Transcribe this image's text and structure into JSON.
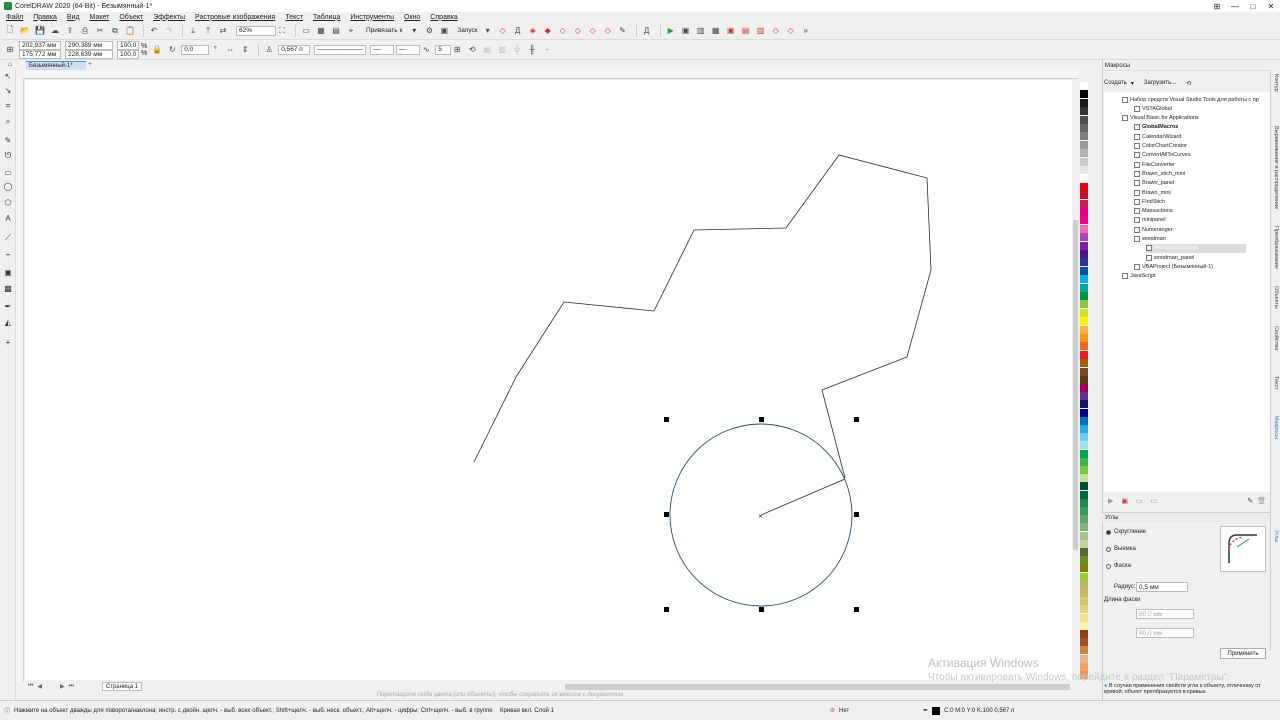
{
  "window": {
    "title": "CorelDRAW 2020 (64-Bit) - Безымянный-1*"
  },
  "menu": [
    "Файл",
    "Правка",
    "Вид",
    "Макет",
    "Объект",
    "Эффекты",
    "Растровые изображения",
    "Текст",
    "Таблица",
    "Инструменты",
    "Окно",
    "Справка"
  ],
  "toolbar1": {
    "zoom": "62%",
    "snap_label": "Привязать к",
    "launch_label": "Запуск"
  },
  "toolbar2": {
    "x": "202,937 мм",
    "y": "175,772 мм",
    "w": "290,389 мм",
    "h": "228,639 мм",
    "scale_w": "100,0",
    "scale_h": "100,0",
    "percent": "%",
    "angle": "0,0",
    "outline_width": "0,567 п",
    "curve_nodes": "5"
  },
  "document": {
    "tab": "Безымянный-1*",
    "page_tab": "Страница 1"
  },
  "canvas_hint": "Перетащите сюда цвета (или объекты), чтобы сохранить их вместе с документом",
  "status": {
    "message": "Нажмите на объект дважды для поворота/наклона; инстр. с двойн. щелч. - выб. всех объект.; Shift+щелч. - выб. неск. объект.; Alt+щелч. - цифры; Ctrl+щелч. - выб. в группе",
    "layer": "Кривая вкл. Слой 1",
    "fill": "Нет",
    "outline": "C:0 M:0 Y:0 K:100  0,567 п"
  },
  "macros": {
    "panel_title": "Макросы",
    "create": "Создать",
    "load": "Загрузить...",
    "tree": [
      {
        "label": "Набор средств Visual Studio Tools для работы с пр",
        "level": 0
      },
      {
        "label": "VSTAGlobal",
        "level": 1
      },
      {
        "label": "Visual Basic for Applications",
        "level": 0
      },
      {
        "label": "GlobalMacros",
        "level": 1,
        "bold": true
      },
      {
        "label": "CalendarWizard",
        "level": 1
      },
      {
        "label": "ColorChartCreator",
        "level": 1
      },
      {
        "label": "ConvertAllToCurves",
        "level": 1
      },
      {
        "label": "FileConverter",
        "level": 1
      },
      {
        "label": "Brawo_stich_mini",
        "level": 1
      },
      {
        "label": "Brawo_panel",
        "level": 1
      },
      {
        "label": "Brawo_mini",
        "level": 1
      },
      {
        "label": "FindStich",
        "level": 1
      },
      {
        "label": "Massactions",
        "level": 1
      },
      {
        "label": "minipanel",
        "level": 1
      },
      {
        "label": "Numeranger",
        "level": 1
      },
      {
        "label": "woodman",
        "level": 1
      },
      {
        "label": "WoodmanStorage",
        "level": 2,
        "selected": true
      },
      {
        "label": "woodman_panel",
        "level": 2
      },
      {
        "label": "VBAProject (Безымянный-1)",
        "level": 1
      },
      {
        "label": "JavaScript",
        "level": 0
      }
    ]
  },
  "corners": {
    "title": "Углы",
    "options": [
      "Скругление",
      "Выемка",
      "Фаска"
    ],
    "radius_label": "Радиус:",
    "radius": "0,5 мм",
    "chamfer_label": "Длина фаски",
    "chamfer1": "80,0 мм",
    "chamfer2": "80,0 мм",
    "apply": "Применить",
    "info": "В случае применения свойств угла к объекту, отличному от кривой, объект преобразуется в кривые."
  },
  "side_tabs": [
    "Контур",
    "Выравнивание и распределение",
    "Преобразование",
    "Объекты",
    "Свойства",
    "Текст",
    "Макросы",
    "Углы"
  ],
  "watermark": {
    "line1": "Активация Windows",
    "line2": "Чтобы активировать Windows, перейдите в раздел \"Параметры\"."
  },
  "colors": {
    "accent": "#2f7bd1",
    "selection": "#000000",
    "outline": "#2a3a4a"
  }
}
